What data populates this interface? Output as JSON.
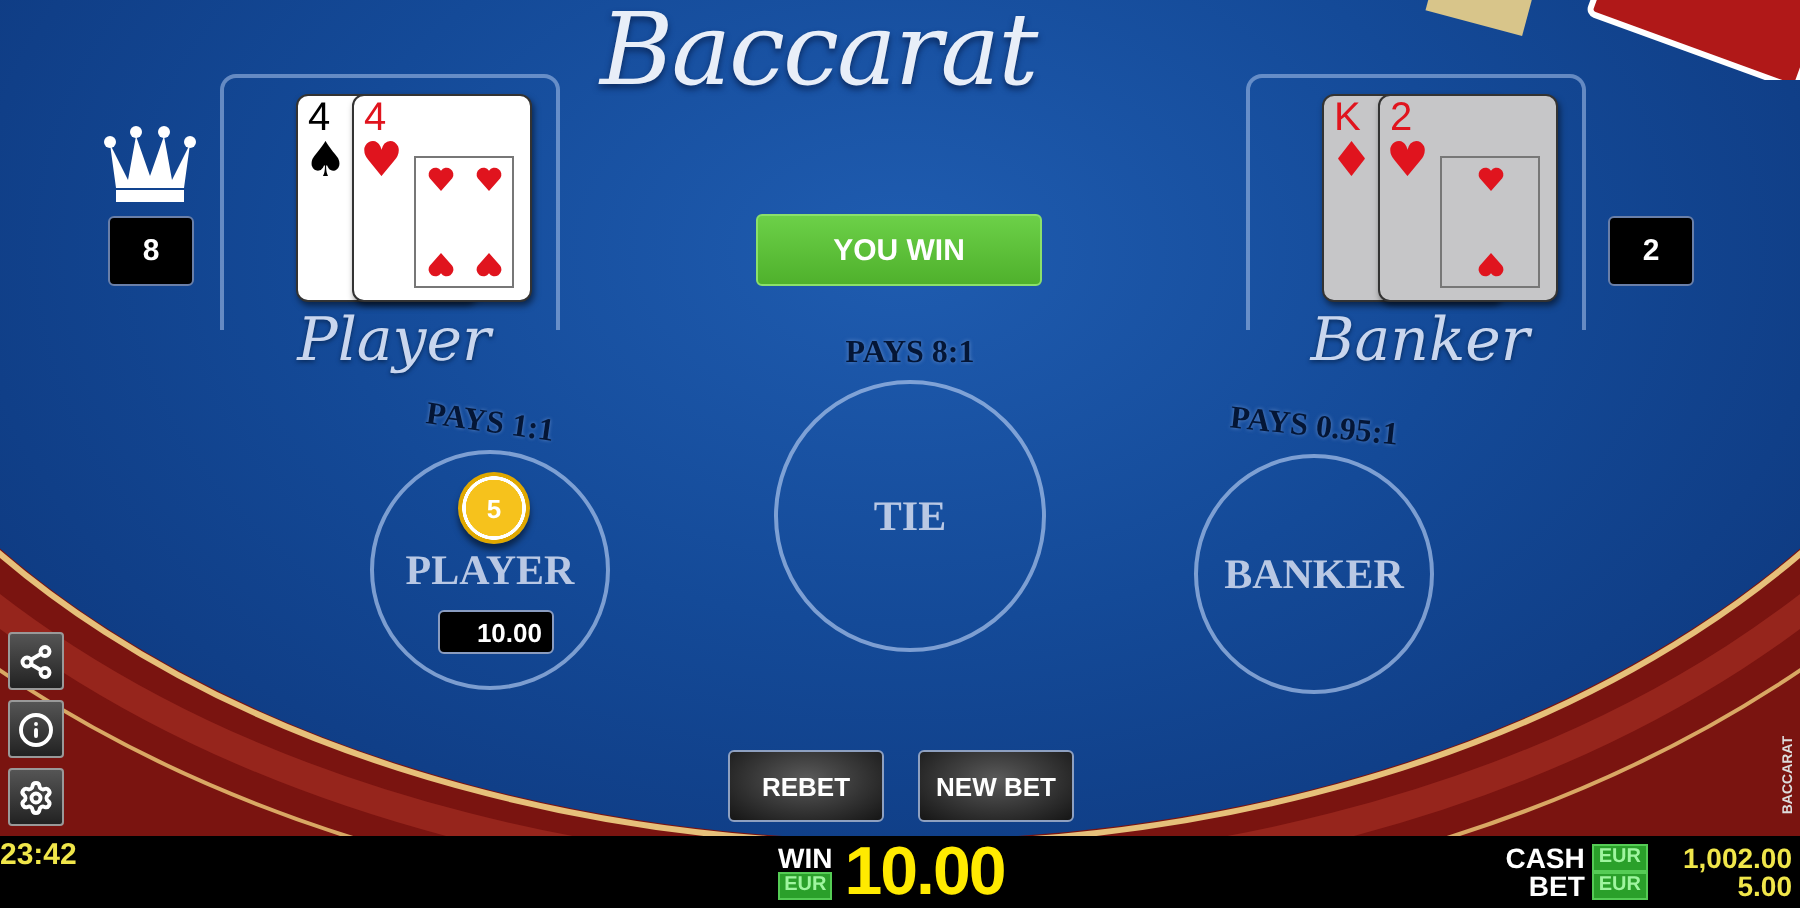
{
  "title": "Baccarat",
  "result": "YOU WIN",
  "hands": [
    {
      "name": "Player",
      "score": "8",
      "winner": true,
      "cards": [
        {
          "rank": "4",
          "suit": "♠",
          "color": "#000000"
        },
        {
          "rank": "4",
          "suit": "♥",
          "color": "#e0141e",
          "kind": "heart"
        }
      ]
    },
    {
      "name": "Banker",
      "score": "2",
      "winner": false,
      "cards": [
        {
          "rank": "K",
          "suit": "♦",
          "color": "#e0141e"
        },
        {
          "rank": "2",
          "suit": "♥",
          "color": "#e0141e",
          "kind": "heart"
        }
      ]
    }
  ],
  "bets": [
    {
      "label": "PLAYER",
      "pays": "PAYS 1:1",
      "chip": "5",
      "stake": "10.00"
    },
    {
      "label": "TIE",
      "pays": "PAYS 8:1"
    },
    {
      "label": "BANKER",
      "pays": "PAYS 0.95:1"
    }
  ],
  "side_buttons": [
    {
      "kind": "share"
    },
    {
      "kind": "info"
    },
    {
      "kind": "settings"
    }
  ],
  "actions": [
    "REBET",
    "NEW BET"
  ],
  "status_bar": {
    "time": "23:42",
    "win": {
      "label": "WIN",
      "currency": "EUR",
      "amount": "10.00"
    },
    "cash": {
      "label": "CASH",
      "currency": "EUR",
      "amount": "1,002.00"
    },
    "bet": {
      "label": "BET",
      "currency": "EUR",
      "amount": "5.00"
    },
    "game_name": "BACCARAT"
  }
}
